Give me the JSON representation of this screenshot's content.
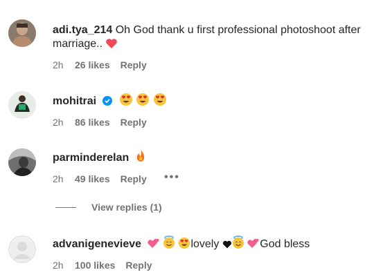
{
  "comments": [
    {
      "username": "adi.tya_214",
      "text": "Oh God thank u first professional photoshoot after",
      "text2": "marriage..",
      "time": "2h",
      "likes": "26 likes",
      "reply": "Reply"
    },
    {
      "username": "mohitrai",
      "verified": true,
      "time": "2h",
      "likes": "86 likes",
      "reply": "Reply"
    },
    {
      "username": "parminderelan",
      "time": "2h",
      "likes": "49 likes",
      "reply": "Reply",
      "more": "•••"
    },
    {
      "username": "advanigenevieve",
      "text_a": "lovely",
      "text_b": "God bless",
      "time": "2h",
      "likes": "100 likes",
      "reply": "Reply"
    }
  ],
  "view_replies": "View replies (1)",
  "colors": {
    "text": "#262626",
    "muted": "#737373",
    "verified": "#0095f6",
    "heart": "#ed4956"
  }
}
